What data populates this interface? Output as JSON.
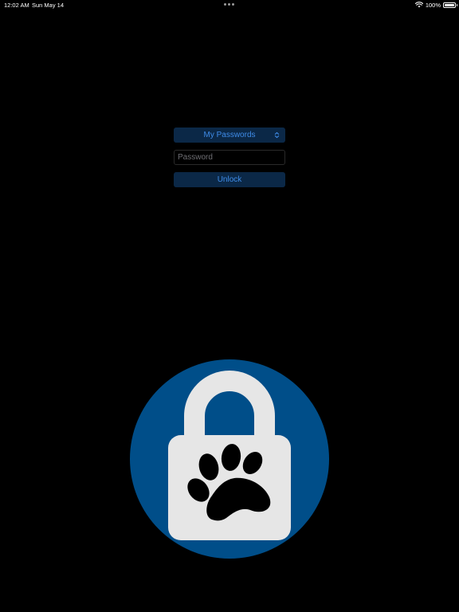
{
  "status_bar": {
    "time": "12:02 AM",
    "date": "Sun May 14",
    "battery_percent_label": "100%",
    "battery_level": 1.0,
    "icons": [
      "wifi-icon",
      "battery-icon"
    ]
  },
  "unlock_form": {
    "vault_selector": {
      "selected": "My Passwords",
      "icon": "chevron-updown-icon"
    },
    "password": {
      "placeholder": "Password",
      "value": ""
    },
    "unlock_label": "Unlock"
  },
  "logo": {
    "icon": "padlock-paw-icon",
    "colors": {
      "circle": "#004e89",
      "lock": "#e6e6e6",
      "paw": "#000000"
    }
  },
  "colors": {
    "background": "#000000",
    "control_background": "#0b2847",
    "accent_text": "#3f8ce8",
    "placeholder_text": "#6e6e73"
  }
}
